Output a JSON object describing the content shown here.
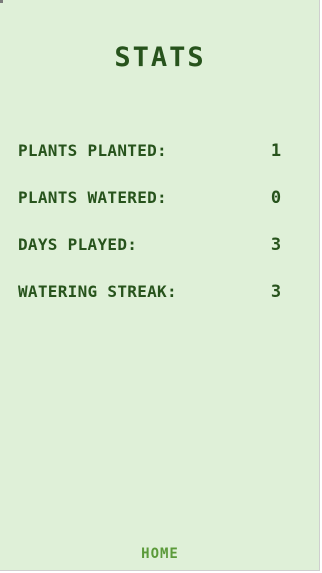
{
  "title": "STATS",
  "stats": [
    {
      "label": "PLANTS PLANTED:",
      "value": "1"
    },
    {
      "label": "PLANTS WATERED:",
      "value": "0"
    },
    {
      "label": "DAYS PLAYED:",
      "value": "3"
    },
    {
      "label": "WATERING STREAK:",
      "value": "3"
    }
  ],
  "home_label": "HOME",
  "colors": {
    "background": "#dff0d8",
    "text_dark_green": "#27531c",
    "button_green": "#5b9a3a"
  }
}
